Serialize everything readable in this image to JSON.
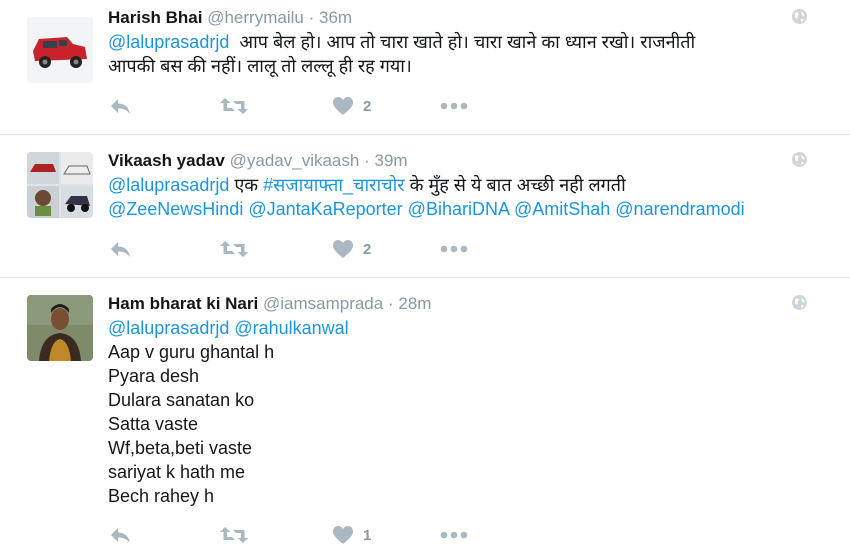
{
  "tweets": [
    {
      "name": "Harish Bhai",
      "handle": "@herrymailu",
      "dot": "·",
      "time": "36m",
      "lines": [
        [
          {
            "text": "@laluprasadrjd",
            "link": true
          },
          {
            "text": "  आप बेल हो। आप तो चारा खाते हो। चारा खाने का ध्यान रखो। राजनीती",
            "link": false
          }
        ],
        [
          {
            "text": "आपकी बस की नहीं। लालू तो लल्लू ही रह गया।",
            "link": false
          }
        ]
      ],
      "like_count": "2"
    },
    {
      "name": "Vikaash yadav",
      "handle": "@yadav_vikaash",
      "dot": "·",
      "time": "39m",
      "lines": [
        [
          {
            "text": "@laluprasadrjd",
            "link": true
          },
          {
            "text": " एक ",
            "link": false
          },
          {
            "text": "#सजायाफ्ता_चाराचोर",
            "link": true
          },
          {
            "text": " के मुँह से ये बात अच्छी नही लगती",
            "link": false
          }
        ],
        [
          {
            "text": "@ZeeNewsHindi @JantaKaReporter @BihariDNA @AmitShah @narendramodi",
            "link": true
          }
        ]
      ],
      "like_count": "2"
    },
    {
      "name": "Ham bharat ki Nari",
      "handle": "@iamsamprada",
      "dot": "·",
      "time": "28m",
      "lines": [
        [
          {
            "text": "@laluprasadrjd @rahulkanwal",
            "link": true
          }
        ],
        [
          {
            "text": "Aap v guru ghantal h",
            "link": false
          }
        ],
        [
          {
            "text": "Pyara desh",
            "link": false
          }
        ],
        [
          {
            "text": "Dulara sanatan ko",
            "link": false
          }
        ],
        [
          {
            "text": "Satta vaste",
            "link": false
          }
        ],
        [
          {
            "text": "Wf,beta,beti vaste",
            "link": false
          }
        ],
        [
          {
            "text": "sariyat k hath me",
            "link": false
          }
        ],
        [
          {
            "text": "Bech rahey h",
            "link": false
          }
        ]
      ],
      "like_count": "1"
    }
  ],
  "colors": {
    "link": "#1b95e0",
    "meta": "#8899a6",
    "action": "#aab8c2",
    "divider": "#e1e8ed"
  },
  "icons": [
    "reply-icon",
    "retweet-icon",
    "heart-icon",
    "more-icon",
    "globe-icon"
  ]
}
